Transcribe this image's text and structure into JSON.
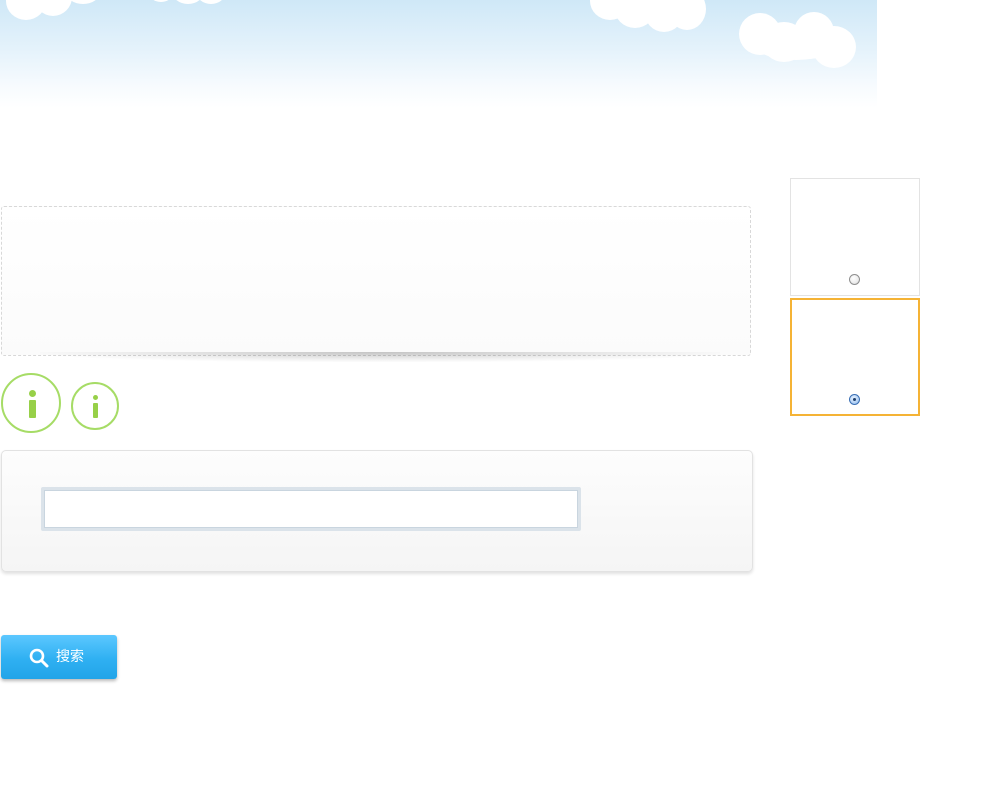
{
  "search": {
    "button_label": "搜索",
    "input_value": "",
    "input_placeholder": ""
  },
  "options": {
    "selected_index": 1,
    "count": 2
  },
  "icons": [
    "info-icon",
    "info-icon",
    "search-icon"
  ],
  "colors": {
    "accent_blue": "#2fb0f2",
    "info_green": "#a6dc66",
    "selected_border": "#f5b335"
  }
}
